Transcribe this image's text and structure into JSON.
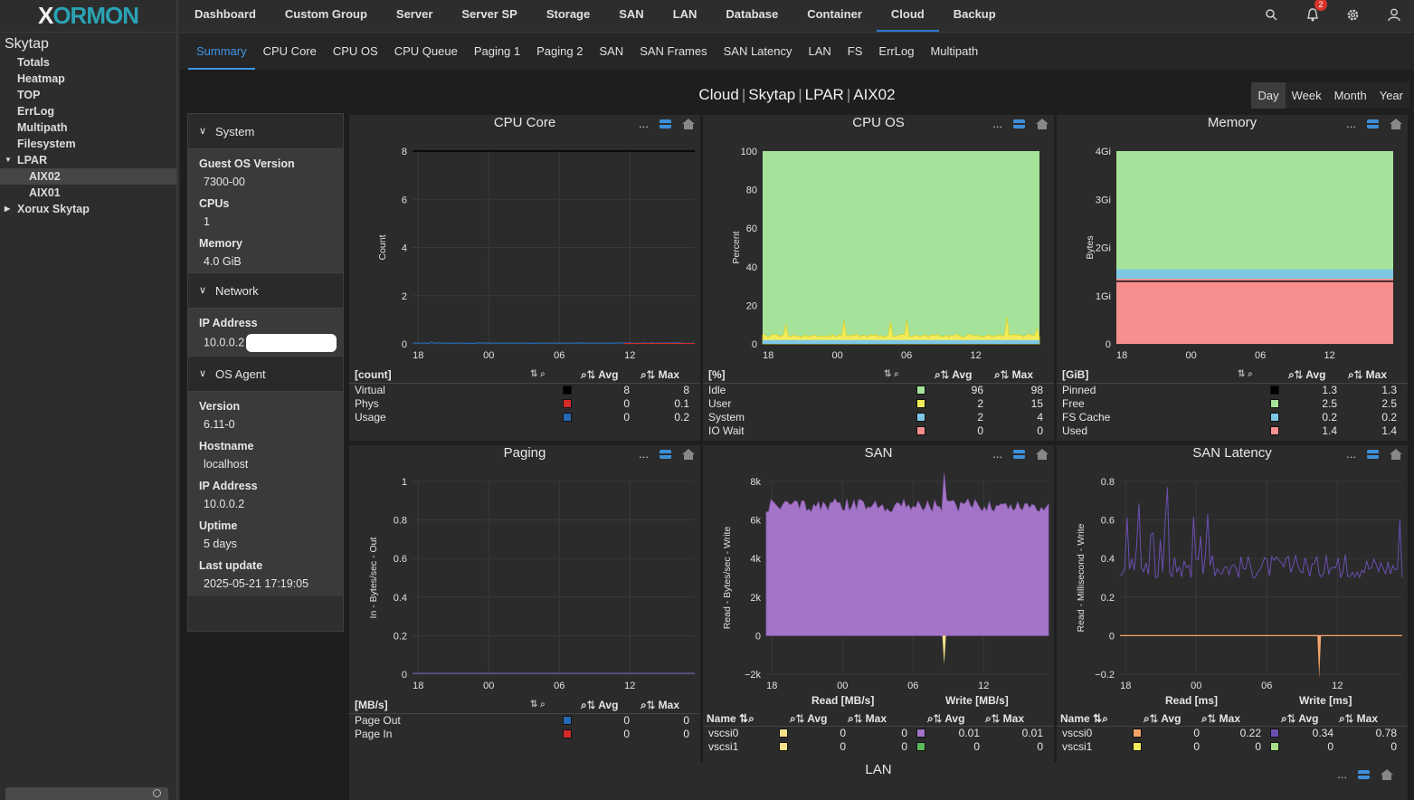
{
  "app": {
    "logo_left": "X",
    "logo_right": "ORMON"
  },
  "sidebar": {
    "title": "Skytap",
    "items": [
      {
        "label": "Totals",
        "level": 1
      },
      {
        "label": "Heatmap",
        "level": 1
      },
      {
        "label": "TOP",
        "level": 1
      },
      {
        "label": "ErrLog",
        "level": 1
      },
      {
        "label": "Multipath",
        "level": 1
      },
      {
        "label": "Filesystem",
        "level": 1
      },
      {
        "label": "LPAR",
        "level": 1,
        "expanded": true
      },
      {
        "label": "AIX02",
        "level": 2,
        "selected": true
      },
      {
        "label": "AIX01",
        "level": 2
      },
      {
        "label": "Xorux Skytap",
        "level": 1,
        "collapsed": true
      }
    ]
  },
  "topnav": {
    "items": [
      "Dashboard",
      "Custom Group",
      "Server",
      "Server SP",
      "Storage",
      "SAN",
      "LAN",
      "Database",
      "Container",
      "Cloud",
      "Backup"
    ],
    "active": "Cloud",
    "icons": [
      "search-icon",
      "bell-icon",
      "gear-icon",
      "user-icon"
    ],
    "notification_count": "2"
  },
  "subnav": {
    "items": [
      "Summary",
      "CPU Core",
      "CPU OS",
      "CPU Queue",
      "Paging 1",
      "Paging 2",
      "SAN",
      "SAN Frames",
      "SAN Latency",
      "LAN",
      "FS",
      "ErrLog",
      "Multipath"
    ],
    "active": "Summary"
  },
  "page": {
    "title_parts": [
      "Cloud",
      "Skytap",
      "LPAR",
      "AIX02"
    ]
  },
  "range": {
    "options": [
      "Day",
      "Week",
      "Month",
      "Year"
    ],
    "active": "Day"
  },
  "info": {
    "sections": [
      {
        "title": "System",
        "fields": [
          {
            "label": "Guest OS Version",
            "value": "7300-00"
          },
          {
            "label": "CPUs",
            "value": "1"
          },
          {
            "label": "Memory",
            "value": "4.0 GiB"
          }
        ]
      },
      {
        "title": "Network",
        "fields": [
          {
            "label": "IP Address",
            "value": "10.0.0.2"
          }
        ]
      },
      {
        "title": "OS Agent",
        "fields": [
          {
            "label": "Version",
            "value": "6.11-0"
          },
          {
            "label": "Hostname",
            "value": "localhost"
          },
          {
            "label": "IP Address",
            "value": "10.0.0.2"
          },
          {
            "label": "Uptime",
            "value": "5 days"
          },
          {
            "label": "Last update",
            "value": "2025-05-21 17:19:05"
          }
        ]
      }
    ]
  },
  "colors": {
    "black": "#000000",
    "red": "#d42a2a",
    "blue": "#2469b5",
    "green": "#a6e39a",
    "yellow": "#f2ec5a",
    "lightblue": "#7ec8e6",
    "pink": "#f78f8f",
    "purple": "#a374c7",
    "orange": "#f5a36b",
    "lgreen": "#a8e08a"
  },
  "panels": [
    {
      "title": "CPU Core",
      "ylabel": "Count",
      "ymax": 8,
      "yticks": [
        "0",
        "2",
        "4",
        "6",
        "8"
      ],
      "xticks": [
        "18",
        "00",
        "06",
        "12"
      ],
      "legend": {
        "unit": "[count]",
        "cols": [
          "Avg",
          "Max"
        ],
        "rows": [
          {
            "name": "Virtual",
            "color": "#000000",
            "avg": "8",
            "max": "8"
          },
          {
            "name": "Phys",
            "color": "#d42a2a",
            "avg": "0",
            "max": "0.1"
          },
          {
            "name": "Usage",
            "color": "#2469b5",
            "avg": "0",
            "max": "0.2"
          }
        ]
      }
    },
    {
      "title": "CPU OS",
      "ylabel": "Percent",
      "ymax": 100,
      "yticks": [
        "0",
        "20",
        "40",
        "60",
        "80",
        "100"
      ],
      "xticks": [
        "18",
        "00",
        "06",
        "12"
      ],
      "legend": {
        "unit": "[%]",
        "cols": [
          "Avg",
          "Max"
        ],
        "rows": [
          {
            "name": "Idle",
            "color": "#a6e39a",
            "avg": "96",
            "max": "98"
          },
          {
            "name": "User",
            "color": "#f2ec5a",
            "avg": "2",
            "max": "15"
          },
          {
            "name": "System",
            "color": "#7ec8e6",
            "avg": "2",
            "max": "4"
          },
          {
            "name": "IO Wait",
            "color": "#f78f8f",
            "avg": "0",
            "max": "0"
          }
        ]
      }
    },
    {
      "title": "Memory",
      "ylabel": "Bytes",
      "ymax": 4,
      "yticks": [
        "0",
        "1Gi",
        "2Gi",
        "3Gi",
        "4Gi"
      ],
      "xticks": [
        "18",
        "00",
        "06",
        "12"
      ],
      "legend": {
        "unit": "[GiB]",
        "cols": [
          "Avg",
          "Max"
        ],
        "rows": [
          {
            "name": "Pinned",
            "color": "#000000",
            "avg": "1.3",
            "max": "1.3"
          },
          {
            "name": "Free",
            "color": "#a6e39a",
            "avg": "2.5",
            "max": "2.5"
          },
          {
            "name": "FS Cache",
            "color": "#7ec8e6",
            "avg": "0.2",
            "max": "0.2"
          },
          {
            "name": "Used",
            "color": "#f78f8f",
            "avg": "1.4",
            "max": "1.4"
          }
        ]
      }
    },
    {
      "title": "Paging",
      "ylabel": "In - Bytes/sec - Out",
      "ymax": 1,
      "yticks": [
        "0",
        "0.2",
        "0.4",
        "0.6",
        "0.8",
        "1"
      ],
      "xticks": [
        "18",
        "00",
        "06",
        "12"
      ],
      "legend": {
        "unit": "[MB/s]",
        "cols": [
          "Avg",
          "Max"
        ],
        "rows": [
          {
            "name": "Page Out",
            "color": "#2469b5",
            "avg": "0",
            "max": "0"
          },
          {
            "name": "Page In",
            "color": "#d42a2a",
            "avg": "0",
            "max": "0"
          }
        ]
      }
    },
    {
      "title": "SAN",
      "ylabel": "Read - Bytes/sec - Write",
      "ymin": -2,
      "ymax": 8,
      "yticks": [
        "−2k",
        "0",
        "2k",
        "4k",
        "6k",
        "8k"
      ],
      "xticks": [
        "18",
        "00",
        "06",
        "12"
      ],
      "legend": {
        "name_header": "Name",
        "group1": "Read [MB/s]",
        "group2": "Write [MB/s]",
        "cols": [
          "Avg",
          "Max",
          "Avg",
          "Max"
        ],
        "rows": [
          {
            "name": "vscsi0",
            "color1": "#f5e18a",
            "color2": "#a374c7",
            "v": [
              "0",
              "0",
              "0.01",
              "0.01"
            ]
          },
          {
            "name": "vscsi1",
            "color1": "#f5e18a",
            "color2": "#5fb85a",
            "v": [
              "0",
              "0",
              "0",
              "0"
            ]
          }
        ]
      }
    },
    {
      "title": "SAN Latency",
      "ylabel": "Read - Millisecond - Write",
      "ymin": -0.2,
      "ymax": 0.8,
      "yticks": [
        "−0.2",
        "0",
        "0.2",
        "0.4",
        "0.6",
        "0.8"
      ],
      "xticks": [
        "18",
        "00",
        "06",
        "12"
      ],
      "legend": {
        "name_header": "Name",
        "group1": "Read [ms]",
        "group2": "Write [ms]",
        "cols": [
          "Avg",
          "Max",
          "Avg",
          "Max"
        ],
        "rows": [
          {
            "name": "vscsi0",
            "color1": "#f5a36b",
            "color2": "#6a4fb0",
            "v": [
              "0",
              "0.22",
              "0.34",
              "0.78"
            ]
          },
          {
            "name": "vscsi1",
            "color1": "#f2ec5a",
            "color2": "#a8e08a",
            "v": [
              "0",
              "0",
              "0",
              "0"
            ]
          }
        ]
      }
    }
  ],
  "lan_panel": {
    "title": "LAN"
  }
}
